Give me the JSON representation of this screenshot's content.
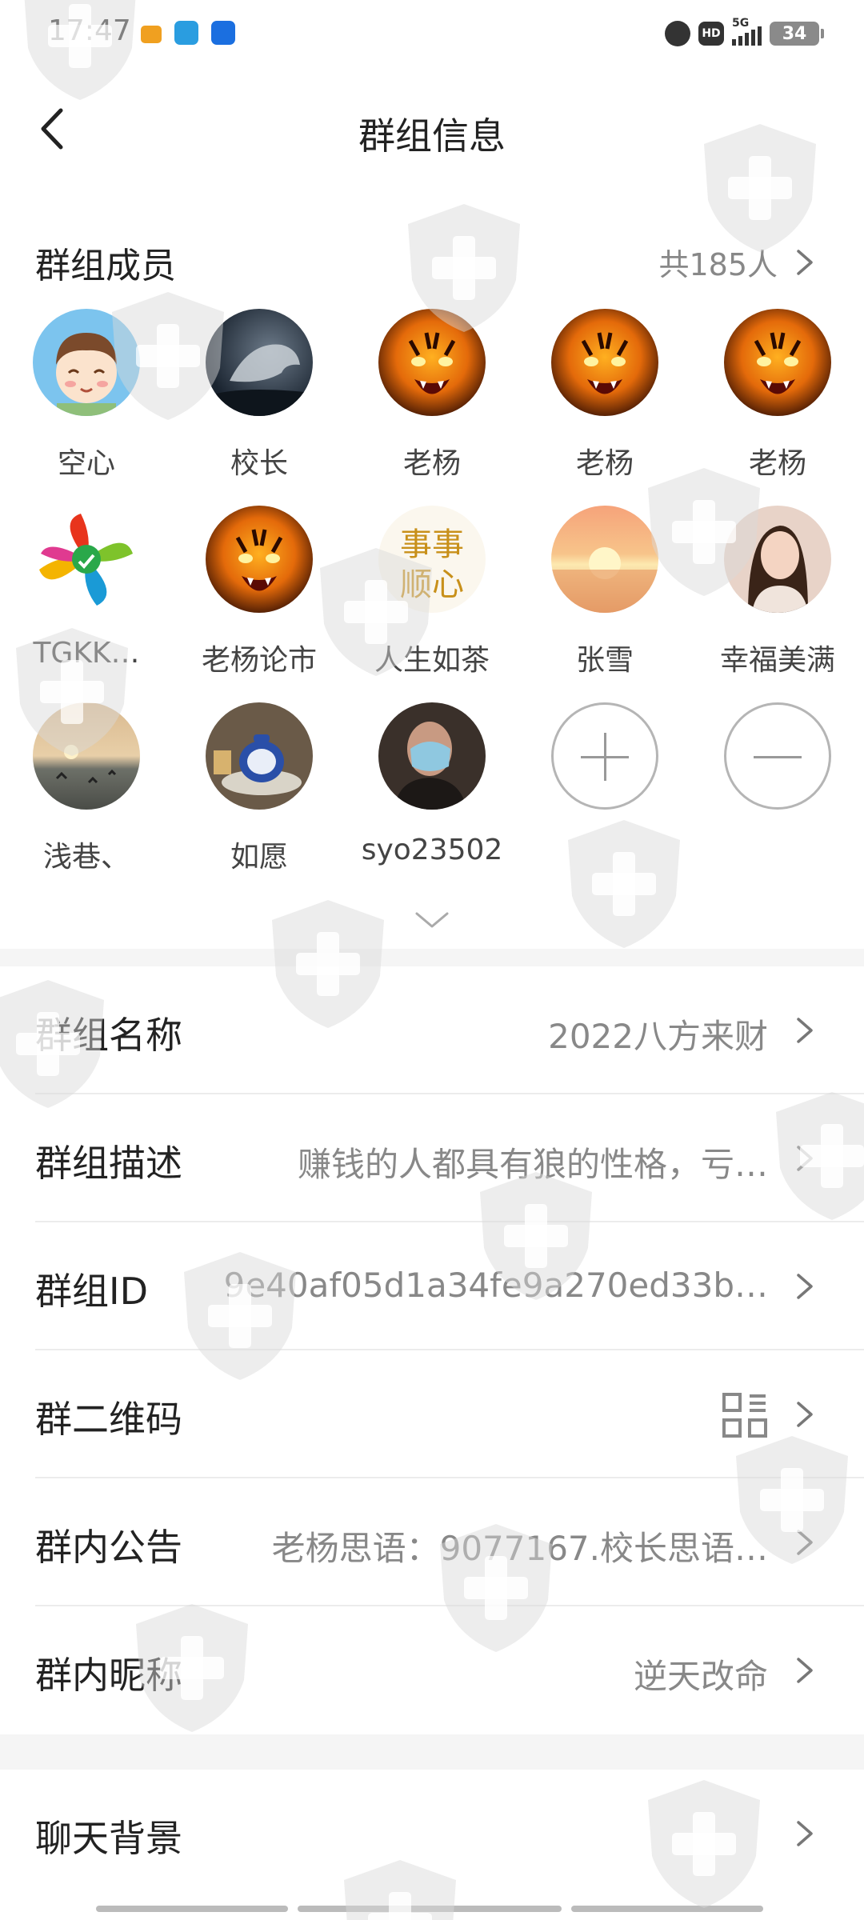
{
  "status_bar": {
    "time": "17:47",
    "battery": "34",
    "hd": "HD",
    "network": "5G"
  },
  "nav": {
    "title": "群组信息"
  },
  "members": {
    "title": "群组成员",
    "count_label": "共185人",
    "list": [
      {
        "name": "空心"
      },
      {
        "name": "校长"
      },
      {
        "name": "老杨"
      },
      {
        "name": "老杨"
      },
      {
        "name": "老杨"
      },
      {
        "name": "TGKK…"
      },
      {
        "name": "老杨论市"
      },
      {
        "name": "人生如茶",
        "avatar_text": "事事顺心"
      },
      {
        "name": "张雪"
      },
      {
        "name": "幸福美满"
      },
      {
        "name": "浅巷、"
      },
      {
        "name": "如愿"
      },
      {
        "name": "syo23502"
      }
    ]
  },
  "settings": {
    "group_name": {
      "label": "群组名称",
      "value": "2022八方来财"
    },
    "group_desc": {
      "label": "群组描述",
      "value": "赚钱的人都具有狼的性格，亏…"
    },
    "group_id": {
      "label": "群组ID",
      "value": "9e40af05d1a34fe9a270ed33b…"
    },
    "group_qr": {
      "label": "群二维码"
    },
    "group_notice": {
      "label": "群内公告",
      "value": "老杨思语：9077167.校长思语…"
    },
    "group_nick": {
      "label": "群内昵称",
      "value": "逆天改命"
    },
    "chat_bg": {
      "label": "聊天背景"
    }
  },
  "colors": {
    "divider": "#ececec",
    "secondary_text": "#888888",
    "section_bg": "#f5f5f5"
  }
}
